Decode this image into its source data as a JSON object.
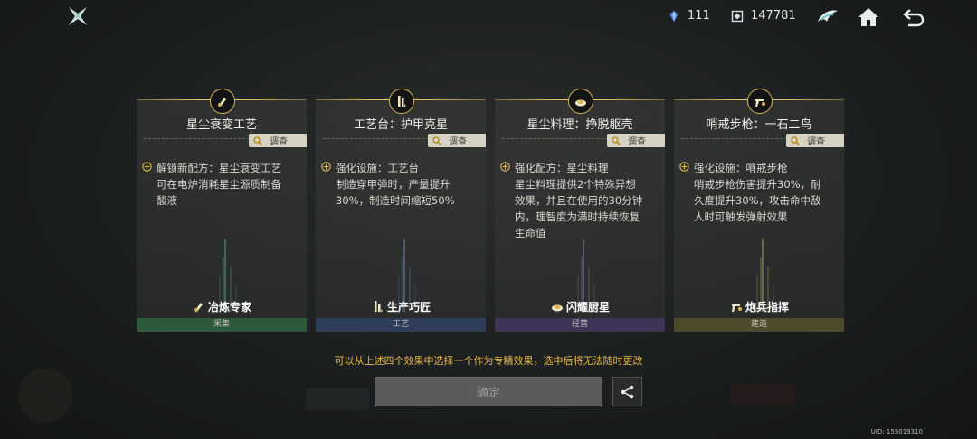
{
  "topbar": {
    "crystal_count": "111",
    "coin_count": "147781",
    "icons": [
      "logo-icon",
      "crystal-icon",
      "coin-icon",
      "wing-icon",
      "home-icon",
      "back-icon"
    ]
  },
  "cards": [
    {
      "title": "星尘衰变工艺",
      "investigate": "调查",
      "desc": [
        "解锁新配方：星尘衰变工艺",
        "可在电炉消耗星尘源质制备",
        "酸液"
      ],
      "role": "冶炼专家",
      "category": "采集",
      "category_color": "#2d5a3a",
      "beam_color": "#6fd0a0"
    },
    {
      "title": "工艺台：护甲克星",
      "investigate": "调查",
      "desc": [
        "强化设施：工艺台",
        "制造穿甲弹时，产量提升",
        "30%，制造时间缩短50%"
      ],
      "role": "生产巧匠",
      "category": "工艺",
      "category_color": "#2e3d5c",
      "beam_color": "#8fb0e8"
    },
    {
      "title": "星尘料理：挣脱躯壳",
      "investigate": "调查",
      "desc": [
        "强化配方：星尘料理",
        "星尘料理提供2个特殊异想",
        "效果，并且在使用的30分钟",
        "内，理智度为满时持续恢复",
        "生命值"
      ],
      "role": "闪耀厨星",
      "category": "经营",
      "category_color": "#3d3458",
      "beam_color": "#b9a4e8"
    },
    {
      "title": "哨戒步枪：一石二鸟",
      "investigate": "调查",
      "desc": [
        "强化设施：哨戒步枪",
        "哨戒步枪伤害提升30%，耐",
        "久度提升30%，攻击命中敌",
        "人时可触发弹射效果"
      ],
      "role": "炮兵指挥",
      "category": "建造",
      "category_color": "#4f4a2c",
      "beam_color": "#e8d28f"
    }
  ],
  "hint": "可以从上述四个效果中选择一个作为专精效果，选中后将无法随时更改",
  "confirm_label": "确定",
  "uid": "UID: 155019310",
  "colors": {
    "accent_gold": "#d9b45a",
    "hint": "#e8b94a"
  }
}
